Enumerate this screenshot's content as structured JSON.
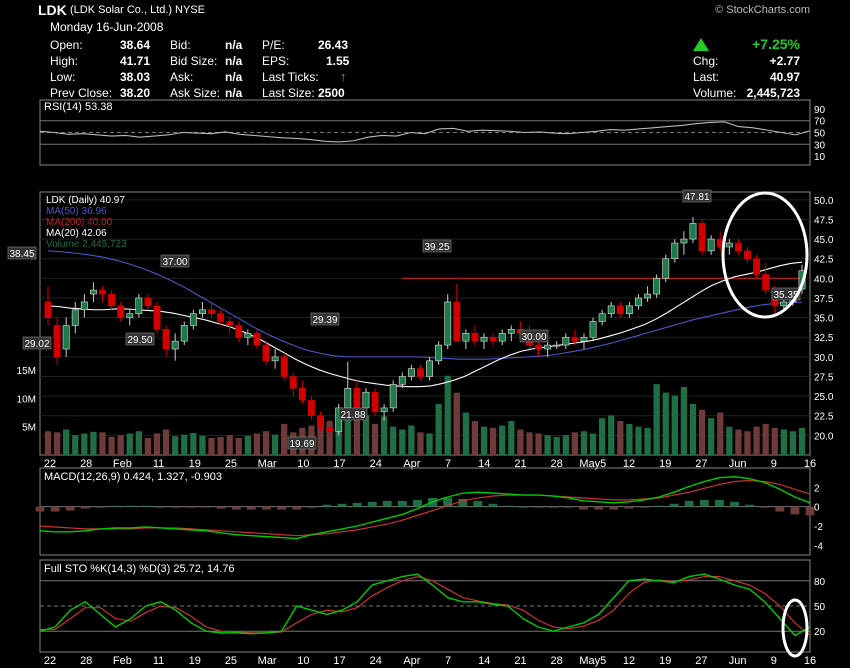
{
  "header": {
    "symbol": "LDK",
    "company": "(LDK Solar Co., Ltd.)",
    "exchange": "NYSE",
    "watermark": "© StockCharts.com",
    "date": "Monday 16-Jun-2008",
    "stats": {
      "open_label": "Open:",
      "open": "38.64",
      "high_label": "High:",
      "high": "41.71",
      "low_label": "Low:",
      "low": "38.03",
      "prev_label": "Prev Close:",
      "prev": "38.20",
      "bid_label": "Bid:",
      "bid": "n/a",
      "bidsize_label": "Bid Size:",
      "bidsize": "n/a",
      "ask_label": "Ask:",
      "ask": "n/a",
      "asksize_label": "Ask Size:",
      "asksize": "n/a",
      "pe_label": "P/E:",
      "pe": "26.43",
      "eps_label": "EPS:",
      "eps": "1.55",
      "lastticks_label": "Last Ticks:",
      "lastsize_label": "Last Size:",
      "lastsize": "2500",
      "pct_change": "+7.25%",
      "chg_label": "Chg:",
      "chg": "+2.77",
      "last_label": "Last:",
      "last": "40.97",
      "volume_label": "Volume:",
      "volume": "2,445,723"
    },
    "up_color": "#22cc22"
  },
  "colors": {
    "up": "#1f7a4a",
    "down": "#d40000",
    "ma50": "#4b55c8",
    "ma200": "#c02020",
    "ma20": "#ffffff",
    "vol_up": "#1f6e46",
    "vol_down": "#6e3a3a",
    "grid": "#555555",
    "line2": "#00cc00"
  },
  "chart_data": [
    {
      "type": "line",
      "title": "RSI(14) 53.38",
      "ylim": [
        0,
        100
      ],
      "yticks": [
        "90",
        "70",
        "50",
        "30",
        "10"
      ],
      "reference_lines": [
        70,
        50,
        30
      ],
      "series": [
        {
          "name": "RSI(14)",
          "values": [
            52,
            50,
            47,
            48,
            46,
            44,
            45,
            42,
            44,
            46,
            50,
            49,
            48,
            51,
            47,
            45,
            43,
            41,
            40,
            38,
            35,
            34,
            36,
            42,
            45,
            44,
            50,
            48,
            56,
            57,
            52,
            54,
            53,
            52,
            50,
            51,
            49,
            48,
            50,
            52,
            55,
            54,
            56,
            58,
            60,
            62,
            65,
            67,
            68,
            60,
            58,
            54,
            50,
            46,
            53
          ]
        }
      ]
    },
    {
      "type": "candlestick",
      "title": "LDK (Daily) 40.97",
      "ylim": [
        17.5,
        51
      ],
      "yticks": [
        "50.0",
        "47.5",
        "45.0",
        "42.5",
        "40.0",
        "37.5",
        "35.0",
        "32.5",
        "30.0",
        "27.5",
        "25.0",
        "22.5",
        "20.0"
      ],
      "xticks": [
        "22",
        "28",
        "Feb",
        "11",
        "19",
        "25",
        "Mar",
        "10",
        "17",
        "24",
        "Apr",
        "7",
        "14",
        "21",
        "28",
        "May5",
        "12",
        "19",
        "27",
        "Jun",
        "9",
        "16"
      ],
      "legend": [
        "LDK (Daily) 40.97",
        "MA(50) 36.96",
        "MA(200) 40.00",
        "MA(20) 42.06",
        "Volume 2,445,723"
      ],
      "annotations": [
        "38.45",
        "29.02",
        "37.00",
        "29.50",
        "29.39",
        "19.69",
        "21.88",
        "39.25",
        "30.00",
        "47.81",
        "35.35"
      ],
      "volume_ticks": [
        "15M",
        "10M",
        "5M"
      ],
      "candles": [
        [
          37,
          39,
          34,
          35
        ],
        [
          34,
          35,
          29,
          30
        ],
        [
          31,
          35,
          30,
          34
        ],
        [
          34,
          37,
          33,
          36
        ],
        [
          36,
          38,
          35,
          37
        ],
        [
          38,
          39.5,
          37,
          38.5
        ],
        [
          38.5,
          39,
          37,
          38
        ],
        [
          38,
          38.5,
          36,
          36.5
        ],
        [
          36.5,
          37,
          34.5,
          35
        ],
        [
          35,
          36,
          34,
          35.5
        ],
        [
          35.5,
          38,
          35,
          37.5
        ],
        [
          37.5,
          38,
          36,
          36.5
        ],
        [
          36.5,
          37,
          33,
          33.5
        ],
        [
          33.5,
          34,
          30,
          31
        ],
        [
          31,
          33,
          29.5,
          32
        ],
        [
          32,
          34.5,
          31.5,
          34
        ],
        [
          34,
          36,
          33.5,
          35.5
        ],
        [
          35.5,
          37,
          35,
          36
        ],
        [
          36,
          37,
          35,
          35.5
        ],
        [
          35.5,
          36,
          34,
          34.5
        ],
        [
          34.5,
          35,
          33,
          34
        ],
        [
          34,
          34.5,
          32,
          32.5
        ],
        [
          32.5,
          33.5,
          31.5,
          33
        ],
        [
          33,
          33.5,
          31,
          31.5
        ],
        [
          31.5,
          32,
          29,
          29.5
        ],
        [
          29.5,
          31,
          28.5,
          30
        ],
        [
          30,
          30.5,
          27,
          27.5
        ],
        [
          27.5,
          28,
          25,
          26
        ],
        [
          26,
          27,
          24,
          24.5
        ],
        [
          24.5,
          25,
          22,
          22.5
        ],
        [
          22.5,
          23,
          20.5,
          21
        ],
        [
          21,
          22,
          19.69,
          20.5
        ],
        [
          20.5,
          24,
          20,
          23.5
        ],
        [
          23.5,
          29.39,
          23,
          26
        ],
        [
          26,
          27,
          23,
          23.5
        ],
        [
          23.5,
          26,
          23,
          25.5
        ],
        [
          25.5,
          26,
          22.5,
          23
        ],
        [
          23,
          24,
          21.88,
          23.5
        ],
        [
          23.5,
          27,
          23,
          26.5
        ],
        [
          26.5,
          28,
          26,
          27.5
        ],
        [
          27.5,
          29,
          27,
          28.5
        ],
        [
          28.5,
          29,
          27,
          27.5
        ],
        [
          27.5,
          30,
          27,
          29.5
        ],
        [
          29.5,
          32,
          29,
          31.5
        ],
        [
          31.5,
          38,
          31,
          37
        ],
        [
          37,
          39.25,
          36,
          32
        ],
        [
          32,
          33.5,
          31,
          33
        ],
        [
          33,
          34,
          31.5,
          32
        ],
        [
          32,
          33,
          31,
          32.5
        ],
        [
          32.5,
          33,
          31.5,
          32
        ],
        [
          32,
          33.5,
          31.5,
          33
        ],
        [
          33,
          34,
          32,
          33.5
        ],
        [
          33.5,
          34.5,
          32.5,
          33
        ],
        [
          33,
          34,
          31,
          31.5
        ],
        [
          31.5,
          32.5,
          30,
          31
        ],
        [
          31,
          32,
          30,
          31.5
        ],
        [
          31.5,
          32,
          31,
          31.5
        ],
        [
          31.5,
          33,
          31,
          32.5
        ],
        [
          32.5,
          33.5,
          31.5,
          32
        ],
        [
          32,
          33,
          31,
          32.5
        ],
        [
          32.5,
          35,
          32,
          34.5
        ],
        [
          34.5,
          36,
          34,
          35.5
        ],
        [
          35.5,
          37,
          35,
          36.5
        ],
        [
          36.5,
          37,
          35,
          35.5
        ],
        [
          35.5,
          37,
          35,
          36.5
        ],
        [
          36.5,
          38,
          36,
          37.5
        ],
        [
          37.5,
          39,
          37,
          38
        ],
        [
          38,
          40.5,
          37.5,
          40
        ],
        [
          40,
          43,
          39.5,
          42.5
        ],
        [
          42.5,
          45,
          42,
          44.5
        ],
        [
          44.5,
          46,
          43,
          45
        ],
        [
          45,
          47.81,
          44.5,
          47
        ],
        [
          47,
          47.5,
          43,
          43.5
        ],
        [
          43.5,
          45.5,
          43,
          45
        ],
        [
          45,
          46,
          43.5,
          44
        ],
        [
          44,
          45,
          43,
          44.5
        ],
        [
          44.5,
          45,
          43,
          43.5
        ],
        [
          43.5,
          44,
          42,
          42.5
        ],
        [
          42.5,
          43,
          40,
          40.5
        ],
        [
          40.5,
          42,
          38,
          38.5
        ],
        [
          38.5,
          39,
          35.35,
          36.5
        ],
        [
          36.5,
          37.5,
          36,
          37
        ],
        [
          37,
          38,
          36.5,
          38.2
        ],
        [
          38.64,
          41.71,
          38.03,
          40.97
        ]
      ],
      "ma20": [
        36.5,
        36.4,
        36.2,
        36.1,
        36.0,
        36.0,
        36.1,
        36.1,
        36.0,
        35.9,
        35.8,
        35.6,
        35.3,
        35.0,
        34.7,
        34.3,
        33.9,
        33.4,
        32.8,
        32.1,
        31.3,
        30.5,
        29.7,
        29.0,
        28.4,
        27.9,
        27.5,
        27.1,
        26.8,
        26.6,
        26.4,
        26.3,
        26.2,
        26.2,
        26.3,
        26.6,
        27.0,
        27.5,
        28.2,
        28.9,
        29.6,
        30.2,
        30.7,
        31.0,
        31.2,
        31.4,
        31.6,
        31.8,
        32.0,
        32.3,
        32.7,
        33.1,
        33.6,
        34.1,
        34.8,
        35.6,
        36.5,
        37.4,
        38.3,
        39.1,
        39.7,
        40.2,
        40.5,
        40.8,
        41.2,
        41.6,
        41.9,
        42.06
      ],
      "ma50": [
        43.5,
        43.4,
        43.2,
        43.0,
        42.7,
        42.3,
        41.8,
        41.2,
        40.5,
        39.7,
        38.8,
        37.8,
        36.8,
        35.8,
        34.8,
        33.8,
        32.9,
        32.1,
        31.4,
        30.8,
        30.4,
        30.1,
        30.0,
        30.0,
        30.0,
        30.0,
        30.0,
        30.0,
        29.9,
        29.8,
        29.7,
        29.7,
        29.7,
        29.8,
        29.9,
        30.0,
        30.1,
        30.3,
        30.6,
        30.9,
        31.3,
        31.7,
        32.2,
        32.7,
        33.2,
        33.7,
        34.2,
        34.7,
        35.1,
        35.5,
        35.9,
        36.3,
        36.6,
        36.8,
        36.9,
        36.96
      ],
      "ma200": [
        40,
        40,
        40,
        40,
        40,
        40,
        40,
        40,
        40,
        40,
        40
      ],
      "volume": [
        4.2,
        4.0,
        4.5,
        3.5,
        3.8,
        4.1,
        4.0,
        3.2,
        3.5,
        3.8,
        4.2,
        3.0,
        3.8,
        4.5,
        3.3,
        3.6,
        3.9,
        3.4,
        3.0,
        3.2,
        3.5,
        3.0,
        3.4,
        3.8,
        4.2,
        3.6,
        5.5,
        4.0,
        4.8,
        5.2,
        5.5,
        6.0,
        4.2,
        11.0,
        9.5,
        7.0,
        5.5,
        6.8,
        5.0,
        4.5,
        5.2,
        4.0,
        3.8,
        9.0,
        14.0,
        11.0,
        7.5,
        6.0,
        5.0,
        4.8,
        5.2,
        6.0,
        4.5,
        4.0,
        3.8,
        3.5,
        3.2,
        3.5,
        4.0,
        4.2,
        3.8,
        6.5,
        7.0,
        6.0,
        5.5,
        5.0,
        4.8,
        12.5,
        11.0,
        10.5,
        12.0,
        9.0,
        8.0,
        6.5,
        7.5,
        5.0,
        4.5,
        4.2,
        5.0,
        5.5,
        4.8,
        4.5,
        4.2,
        4.8
      ]
    },
    {
      "type": "line",
      "title": "MACD(12,26,9) 0.424, 1.327, -0.903",
      "ylim": [
        -5,
        4
      ],
      "yticks": [
        "2",
        "0",
        "-2",
        "-4"
      ],
      "series": [
        {
          "name": "MACD(12,26,9)",
          "values": [
            -2.5,
            -2.6,
            -2.6,
            -2.5,
            -2.3,
            -2.2,
            -2.2,
            -2.1,
            -2.2,
            -2.3,
            -2.4,
            -2.5,
            -2.7,
            -2.9,
            -3.0,
            -3.1,
            -3.2,
            -3.3,
            -2.9,
            -2.6,
            -2.3,
            -2.0,
            -1.6,
            -1.2,
            -0.8,
            -0.2,
            0.5,
            1.0,
            1.4,
            1.5,
            1.4,
            1.3,
            1.2,
            1.2,
            1.1,
            0.9,
            0.6,
            0.5,
            0.4,
            0.5,
            0.7,
            1.0,
            1.5,
            2.1,
            2.6,
            3.0,
            3.1,
            2.9,
            2.5,
            1.8,
            1.0,
            0.4
          ]
        },
        {
          "name": "Signal",
          "values": [
            -2.0,
            -2.1,
            -2.2,
            -2.3,
            -2.3,
            -2.3,
            -2.3,
            -2.2,
            -2.2,
            -2.2,
            -2.3,
            -2.4,
            -2.5,
            -2.6,
            -2.7,
            -2.8,
            -2.9,
            -3.0,
            -2.9,
            -2.8,
            -2.6,
            -2.4,
            -2.1,
            -1.8,
            -1.4,
            -0.9,
            -0.4,
            0.1,
            0.6,
            0.9,
            1.1,
            1.2,
            1.2,
            1.2,
            1.1,
            1.0,
            0.9,
            0.8,
            0.7,
            0.7,
            0.8,
            0.9,
            1.2,
            1.5,
            1.9,
            2.3,
            2.6,
            2.7,
            2.6,
            2.3,
            1.8,
            1.3
          ]
        }
      ]
    },
    {
      "type": "line",
      "title": "Full STO %K(14,3) %D(3) 25.72, 14.76",
      "ylim": [
        0,
        100
      ],
      "yticks": [
        "80",
        "50",
        "20"
      ],
      "reference_lines": [
        80,
        50,
        20
      ],
      "series": [
        {
          "name": "%K(14,3)",
          "values": [
            20,
            25,
            45,
            55,
            40,
            25,
            35,
            50,
            55,
            45,
            30,
            20,
            18,
            18,
            17,
            18,
            20,
            50,
            45,
            40,
            45,
            55,
            75,
            80,
            85,
            88,
            75,
            60,
            55,
            55,
            52,
            50,
            35,
            25,
            20,
            25,
            30,
            40,
            60,
            80,
            82,
            80,
            78,
            85,
            88,
            82,
            75,
            70,
            55,
            35,
            15,
            25
          ]
        },
        {
          "name": "%D(3)",
          "values": [
            22,
            22,
            35,
            48,
            48,
            35,
            32,
            42,
            50,
            48,
            38,
            25,
            20,
            19,
            18,
            18,
            19,
            30,
            40,
            45,
            43,
            48,
            62,
            72,
            80,
            85,
            80,
            70,
            60,
            56,
            53,
            51,
            45,
            33,
            25,
            23,
            26,
            33,
            45,
            65,
            78,
            81,
            79,
            81,
            85,
            85,
            80,
            75,
            65,
            50,
            30,
            15
          ]
        }
      ]
    }
  ]
}
